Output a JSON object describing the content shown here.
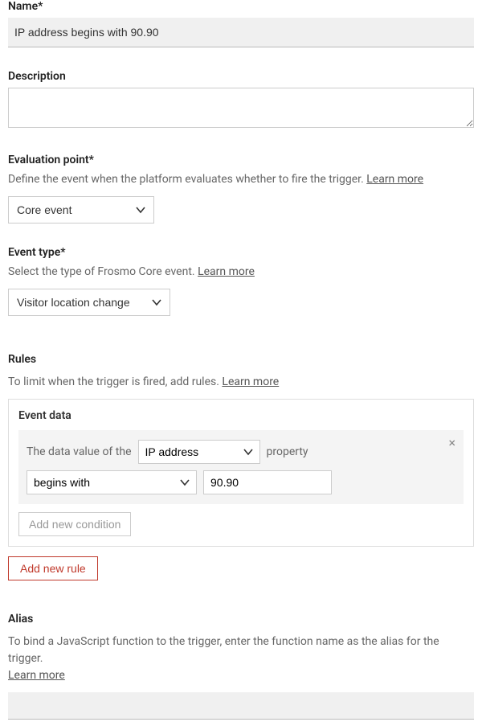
{
  "name": {
    "label": "Name*",
    "value": "IP address begins with 90.90"
  },
  "description": {
    "label": "Description",
    "value": ""
  },
  "evaluation_point": {
    "label": "Evaluation point*",
    "help": "Define the event when the platform evaluates whether to fire the trigger. ",
    "learn_more": "Learn more",
    "selected": "Core event"
  },
  "event_type": {
    "label": "Event type*",
    "help": "Select the type of Frosmo Core event. ",
    "learn_more": "Learn more",
    "selected": "Visitor location change"
  },
  "rules": {
    "title": "Rules",
    "help": "To limit when the trigger is fired, add rules. ",
    "learn_more": "Learn more",
    "box_title": "Event data",
    "text_prefix": "The data value of the",
    "property_select": "IP address",
    "text_suffix": "property",
    "operator_select": "begins with",
    "value_input": "90.90",
    "add_condition": "Add new condition",
    "add_rule": "Add new rule"
  },
  "alias": {
    "title": "Alias",
    "help": "To bind a JavaScript function to the trigger, enter the function name as the alias for the trigger. ",
    "learn_more": "Learn more",
    "value": ""
  }
}
